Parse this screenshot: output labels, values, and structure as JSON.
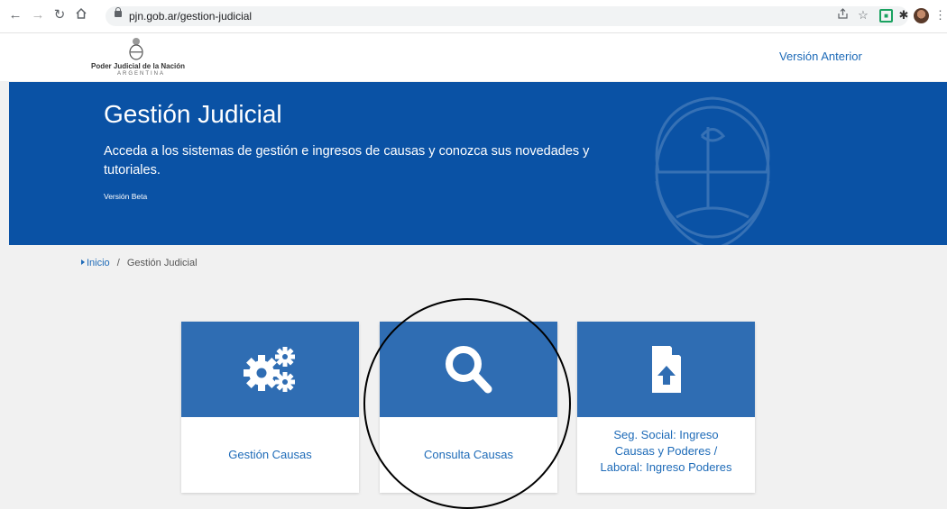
{
  "browser": {
    "url": "pjn.gob.ar/gestion-judicial",
    "icons": [
      "back-icon",
      "forward-icon",
      "reload-icon",
      "home-icon",
      "lock-icon",
      "share-icon",
      "star-icon",
      "extension-icon",
      "puzzle-icon",
      "profile-avatar",
      "menu-icon"
    ]
  },
  "header": {
    "logo_title": "Poder Judicial de la Nación",
    "logo_subtitle": "ARGENTINA",
    "prev_version_link": "Versión Anterior"
  },
  "hero": {
    "title": "Gestión Judicial",
    "description": "Acceda a los sistemas de gestión e ingresos de causas y conozca sus novedades y tutoriales.",
    "beta_label": "Versión Beta"
  },
  "breadcrumb": {
    "home": "Inicio",
    "separator": "/",
    "current": "Gestión Judicial"
  },
  "cards": [
    {
      "label": "Gestión Causas",
      "icon": "gears-icon"
    },
    {
      "label": "Consulta Causas",
      "icon": "search-icon"
    },
    {
      "label_lines": [
        "Seg. Social: Ingreso",
        "Causas y Poderes /",
        "Laboral: Ingreso Poderes"
      ],
      "icon": "file-upload-icon"
    }
  ],
  "colors": {
    "brand_blue": "#0a52a5",
    "card_blue": "#2f6db3",
    "link_blue": "#1e6bb8"
  }
}
